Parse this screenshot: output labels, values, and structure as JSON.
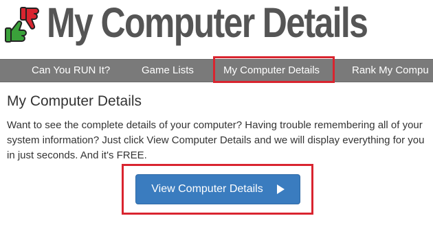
{
  "logo": {
    "text": "My Computer Details",
    "icon": "thumbs-up-down-icon",
    "colors": {
      "thumb_down": "#d9242f",
      "thumb_up": "#3aa13a",
      "text": "#555555"
    }
  },
  "nav": {
    "items": [
      {
        "label": "Can You RUN It?"
      },
      {
        "label": "Game Lists"
      },
      {
        "label": "My Computer Details"
      },
      {
        "label": "Rank My Compu"
      }
    ],
    "background": "#7a7a7a",
    "highlight_color": "#d9242f"
  },
  "main": {
    "title": "My Computer Details",
    "description": "Want to see the complete details of your computer? Having trouble remembering all of your system information? Just click View Computer Details and we will display everything for you in just seconds. And it's FREE.",
    "button": {
      "label": "View Computer Details",
      "icon": "play-icon",
      "color": "#3a7cbf"
    }
  }
}
